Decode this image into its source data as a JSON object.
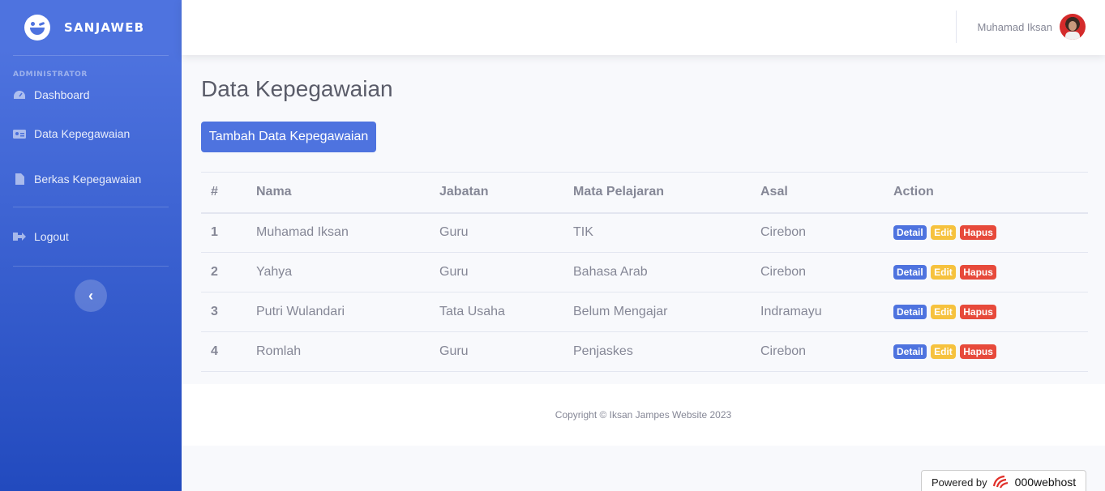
{
  "sidebar": {
    "brand": "SANJAWEB",
    "heading": "ADMINISTRATOR",
    "items": [
      {
        "label": "Dashboard",
        "icon": "dashboard-icon"
      },
      {
        "label": "Data Kepegawaian",
        "icon": "id-card-icon"
      },
      {
        "label": "Berkas Kepegawaian",
        "icon": "file-icon"
      }
    ],
    "logout": "Logout",
    "toggle": "‹"
  },
  "topbar": {
    "user_name": "Muhamad Iksan"
  },
  "main": {
    "title": "Data Kepegawaian",
    "add_button": "Tambah Data Kepegawaian",
    "table": {
      "columns": [
        "#",
        "Nama",
        "Jabatan",
        "Mata Pelajaran",
        "Asal",
        "Action"
      ],
      "rows": [
        {
          "num": "1",
          "nama": "Muhamad Iksan",
          "jabatan": "Guru",
          "mapel": "TIK",
          "asal": "Cirebon"
        },
        {
          "num": "2",
          "nama": "Yahya",
          "jabatan": "Guru",
          "mapel": "Bahasa Arab",
          "asal": "Cirebon"
        },
        {
          "num": "3",
          "nama": "Putri Wulandari",
          "jabatan": "Tata Usaha",
          "mapel": "Belum Mengajar",
          "asal": "Indramayu"
        },
        {
          "num": "4",
          "nama": "Romlah",
          "jabatan": "Guru",
          "mapel": "Penjaskes",
          "asal": "Cirebon"
        }
      ],
      "actions": {
        "detail": "Detail",
        "edit": "Edit",
        "hapus": "Hapus"
      }
    }
  },
  "footer": {
    "copyright": "Copyright © Iksan Jampes Website 2023"
  },
  "powered": {
    "label": "Powered by",
    "brand": "000webhost"
  },
  "colors": {
    "primary": "#4e73df",
    "warning": "#f6c23e",
    "danger": "#e74a3b"
  }
}
